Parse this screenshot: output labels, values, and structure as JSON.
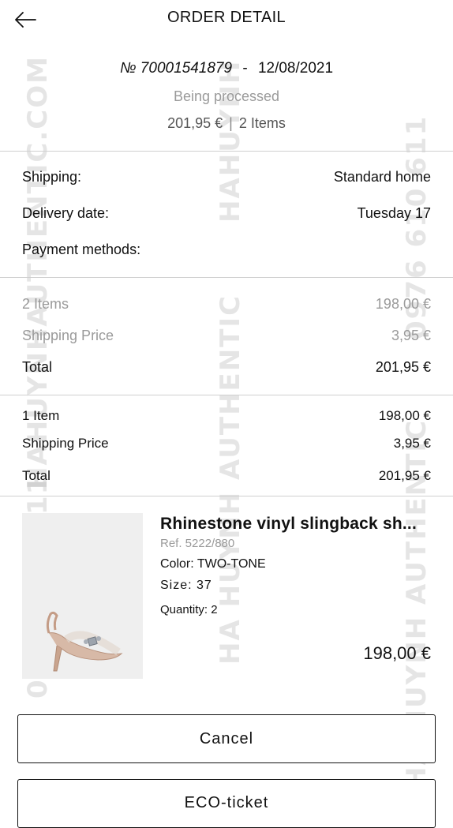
{
  "header": {
    "title": "ORDER DETAIL",
    "back_icon": "arrow-left-icon"
  },
  "order": {
    "number": "№ 70001541879",
    "separator": "-",
    "date": "12/08/2021",
    "status": "Being processed",
    "total": "201,95 €",
    "divider": "|",
    "items_count": "2 Items"
  },
  "details": {
    "shipping_label": "Shipping:",
    "shipping_value": "Standard home",
    "delivery_label": "Delivery date:",
    "delivery_value": "Tuesday 17",
    "payment_label": "Payment methods:"
  },
  "totals_all": {
    "items_label": "2 Items",
    "items_value": "198,00 €",
    "shipping_label": "Shipping Price",
    "shipping_value": "3,95 €",
    "total_label": "Total",
    "total_value": "201,95 €"
  },
  "totals_shipment": {
    "items_label": "1 Item",
    "items_value": "198,00 €",
    "shipping_label": "Shipping Price",
    "shipping_value": "3,95 €",
    "total_label": "Total",
    "total_value": "201,95 €"
  },
  "product": {
    "name": "Rhinestone vinyl slingback sh...",
    "ref": "Ref. 5222/880",
    "color": "Color: TWO-TONE",
    "size": "Size: 37",
    "quantity": "Quantity: 2",
    "price": "198,00 €"
  },
  "buttons": {
    "cancel": "Cancel",
    "eco": "ECO-ticket"
  },
  "watermarks": {
    "a": "HAHUYNHAUTHENTIC.COM",
    "b": "HAHUYNH",
    "c": "0976 610 611",
    "d": "HA HUYNH AUTHENTIC",
    "e": "0976 610 611",
    "f": "HA HUYNH AUTHENTIC"
  }
}
